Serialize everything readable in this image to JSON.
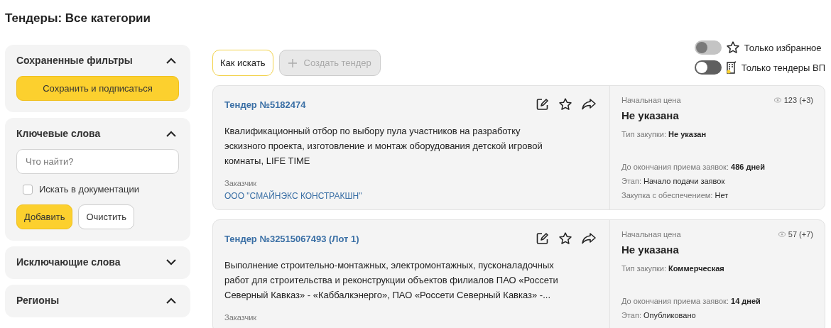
{
  "page_title": "Тендеры: Все категории",
  "sidebar": {
    "panels": [
      {
        "title": "Сохраненные фильтры",
        "expanded": true,
        "button": "Сохранить и подписаться"
      },
      {
        "title": "Ключевые слова",
        "expanded": true,
        "search": {
          "placeholder": "Что найти?"
        },
        "checkbox": {
          "label": "Искать в документации",
          "checked": false
        },
        "buttons": [
          {
            "label": "Добавить",
            "kind": "primary"
          },
          {
            "label": "Очистить",
            "kind": "secondary"
          }
        ]
      },
      {
        "title": "Исключающие слова",
        "expanded": false
      },
      {
        "title": "Регионы",
        "expanded": true
      }
    ]
  },
  "toolbar": {
    "help_button": "Как искать",
    "create_button": {
      "label": "Создать тендер",
      "disabled": true
    }
  },
  "toggles": [
    {
      "label": "Только избранное",
      "on": false,
      "disabled": true,
      "kind": "star"
    },
    {
      "label": "Только тендеры ВП",
      "on": false,
      "disabled": false,
      "kind": "building"
    }
  ],
  "tenders": [
    {
      "title": "Тендер №5182474",
      "description": "Квалификационный отбор по выбору пула участников на разработку эскизного проекта, изготовление и монтаж оборудования детской игровой комнаты, LIFE TIME",
      "customer_label": "Заказчик",
      "customer": "ООО \"СМАЙНЭКС КОНСТРАКШН\"",
      "price_label": "Начальная цена",
      "views": "123 (+3)",
      "price": "Не указана",
      "details_top": [
        {
          "label": "Тип закупки:",
          "value": "Не указан"
        }
      ],
      "details_bottom": [
        {
          "label": "До окончания приема заявок:",
          "value": "486 дней",
          "bold": true
        },
        {
          "label": "Этап:",
          "value": "Начало подачи заявок",
          "bold": false
        },
        {
          "label": "Закупка с обеспечением:",
          "value": "Нет",
          "bold": false
        }
      ]
    },
    {
      "title": "Тендер №32515067493 (Лот 1)",
      "description": "Выполнение строительно-монтажных, электромонтажных, пусконаладочных работ для строительства и реконструкции объектов филиалов ПАО «Россети Северный Кавказ» - «Каббалкэнерго», ПАО «Россети Северный Кавказ» -...",
      "customer_label": "Заказчик",
      "price_label": "Начальная цена",
      "views": "57 (+7)",
      "price": "Не указана",
      "details_top": [
        {
          "label": "Тип закупки:",
          "value": "Коммерческая"
        }
      ],
      "details_bottom": [
        {
          "label": "До окончания приема заявок:",
          "value": "14 дней",
          "bold": true
        },
        {
          "label": "Этап:",
          "value": "Опубликовано",
          "bold": false
        }
      ]
    }
  ]
}
